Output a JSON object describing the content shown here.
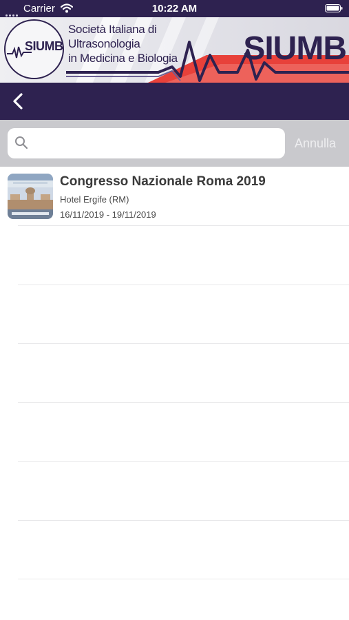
{
  "status_bar": {
    "carrier": "Carrier",
    "time": "10:22 AM"
  },
  "banner": {
    "logo_text": "SIUMB",
    "society_line1": "Società Italiana di Ultrasonologia",
    "society_line2": "in Medicina e Biologia",
    "brand": "SIUMB"
  },
  "search": {
    "value": "",
    "placeholder": "",
    "cancel_label": "Annulla"
  },
  "events": [
    {
      "title": "Congresso Nazionale Roma 2019",
      "venue": "Hotel Ergife (RM)",
      "dates": "16/11/2019 - 19/11/2019"
    }
  ],
  "colors": {
    "primary": "#2e2250",
    "accent": "#e8413a",
    "search_bg": "#c9c9cd"
  }
}
